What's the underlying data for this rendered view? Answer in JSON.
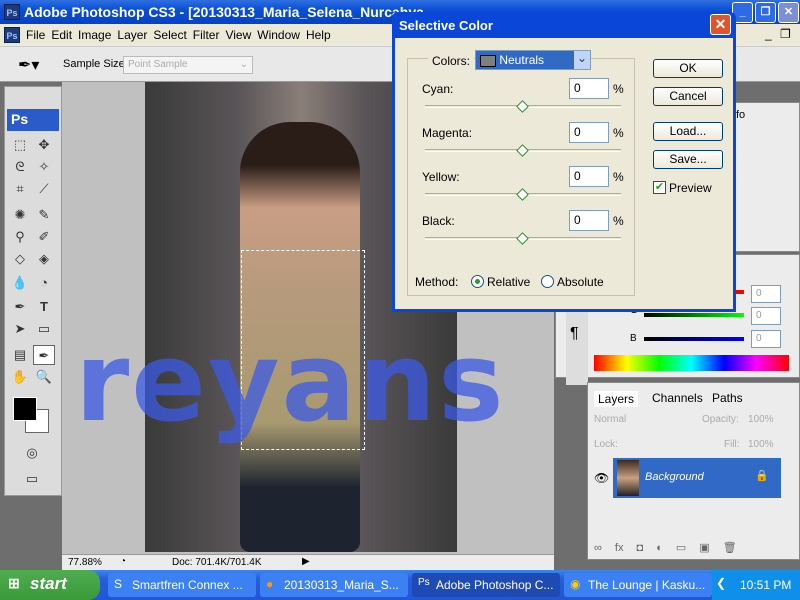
{
  "window": {
    "title": "Adobe Photoshop CS3 - [20130313_Maria_Selena_Nurcahya",
    "app_icon": "ps-icon"
  },
  "menu": [
    "File",
    "Edit",
    "Image",
    "Layer",
    "Select",
    "Filter",
    "View",
    "Window",
    "Help"
  ],
  "options": {
    "sample_size_label": "Sample Size:",
    "sample_size_value": "Point Sample"
  },
  "document": {
    "zoom": "77.88%",
    "doc_info": "Doc: 701.4K/701.4K"
  },
  "dialog": {
    "title": "Selective Color",
    "colors_label": "Colors:",
    "colors_value": "Neutrals",
    "sliders": [
      {
        "label": "Cyan:",
        "value": "0",
        "unit": "%"
      },
      {
        "label": "Magenta:",
        "value": "0",
        "unit": "%"
      },
      {
        "label": "Yellow:",
        "value": "0",
        "unit": "%"
      },
      {
        "label": "Black:",
        "value": "0",
        "unit": "%"
      }
    ],
    "ok": "OK",
    "cancel": "Cancel",
    "load": "Load...",
    "save": "Save...",
    "preview": "Preview",
    "preview_checked": true,
    "method_label": "Method:",
    "method_relative": "Relative",
    "method_absolute": "Absolute",
    "method_selected": "Relative"
  },
  "color_panel": {
    "g_label": "G",
    "b_label": "B",
    "r_value": "0",
    "g_value": "0",
    "b_value": "0"
  },
  "info_tab": "fo",
  "layers_panel": {
    "tabs": [
      "Layers",
      "Channels",
      "Paths"
    ],
    "blend_mode": "Normal",
    "opacity_label": "Opacity:",
    "opacity": "100%",
    "lock_label": "Lock:",
    "fill_label": "Fill:",
    "fill": "100%",
    "layers": [
      {
        "name": "Background",
        "locked": true,
        "visible": true
      }
    ]
  },
  "taskbar": {
    "start": "start",
    "tasks": [
      "Smartfren Connex ...",
      "20130313_Maria_S...",
      "Adobe Photoshop C...",
      "The Lounge | Kasku..."
    ],
    "active_task": 2,
    "clock": "10:51 PM"
  },
  "watermark": "reyans"
}
